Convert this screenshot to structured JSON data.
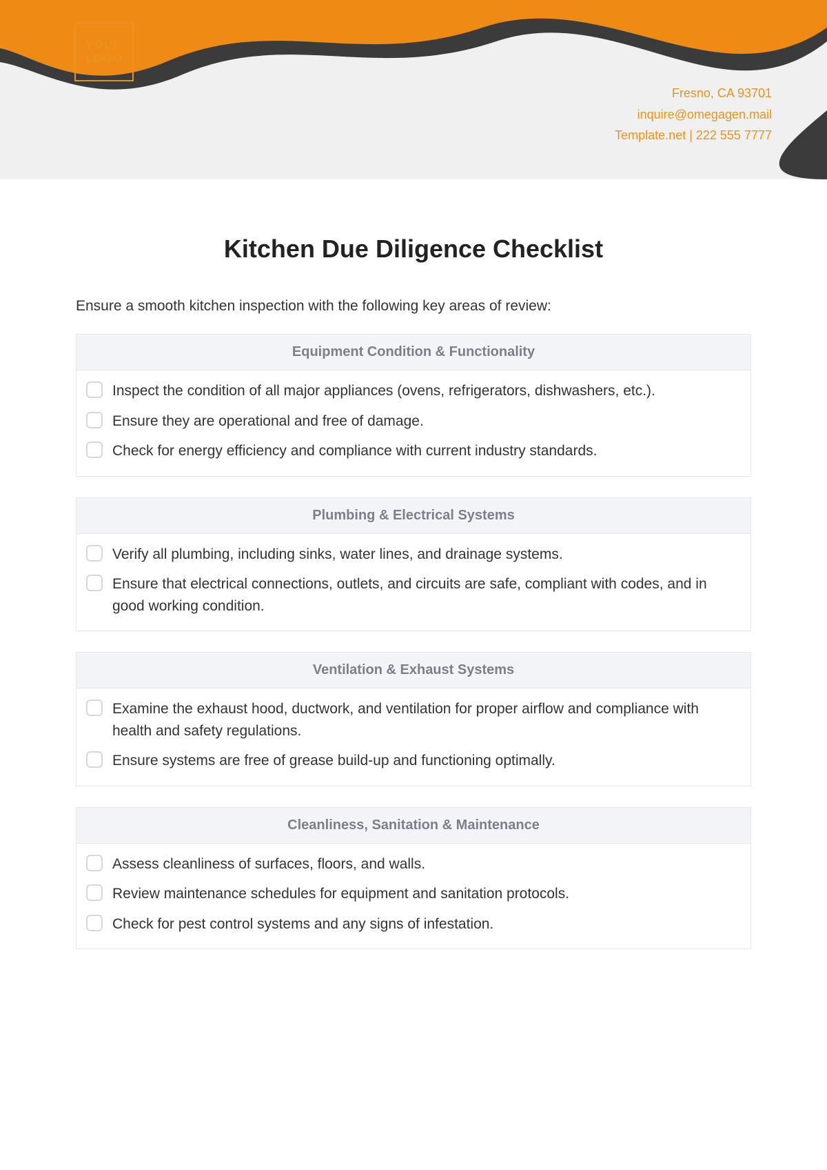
{
  "header": {
    "logo_line1": "YOUR",
    "logo_line2": "LOGO",
    "contact": {
      "address": "Fresno, CA 93701",
      "email": "inquire@omegagen.mail",
      "site_phone": "Template.net  |  222 555 7777"
    }
  },
  "title": "Kitchen Due Diligence Checklist",
  "intro": "Ensure a smooth kitchen inspection with the following key areas of review:",
  "sections": [
    {
      "heading": "Equipment Condition & Functionality",
      "items": [
        "Inspect the condition of all major appliances (ovens, refrigerators, dishwashers, etc.).",
        "Ensure they are operational and free of damage.",
        "Check for energy efficiency and compliance with current industry standards."
      ]
    },
    {
      "heading": "Plumbing & Electrical Systems",
      "items": [
        "Verify all plumbing, including sinks, water lines, and drainage systems.",
        "Ensure that electrical connections, outlets, and circuits are safe, compliant with codes, and in good working condition."
      ]
    },
    {
      "heading": "Ventilation & Exhaust Systems",
      "items": [
        "Examine the exhaust hood, ductwork, and ventilation for proper airflow and compliance with health and safety regulations.",
        "Ensure systems are free of grease build-up and functioning optimally."
      ]
    },
    {
      "heading": "Cleanliness, Sanitation & Maintenance",
      "items": [
        "Assess cleanliness of surfaces, floors, and walls.",
        "Review maintenance schedules for equipment and sanitation protocols.",
        "Check for pest control systems and any signs of infestation."
      ]
    }
  ],
  "colors": {
    "accent": "#ef8b15",
    "wave_dark": "#3b3b3b"
  }
}
